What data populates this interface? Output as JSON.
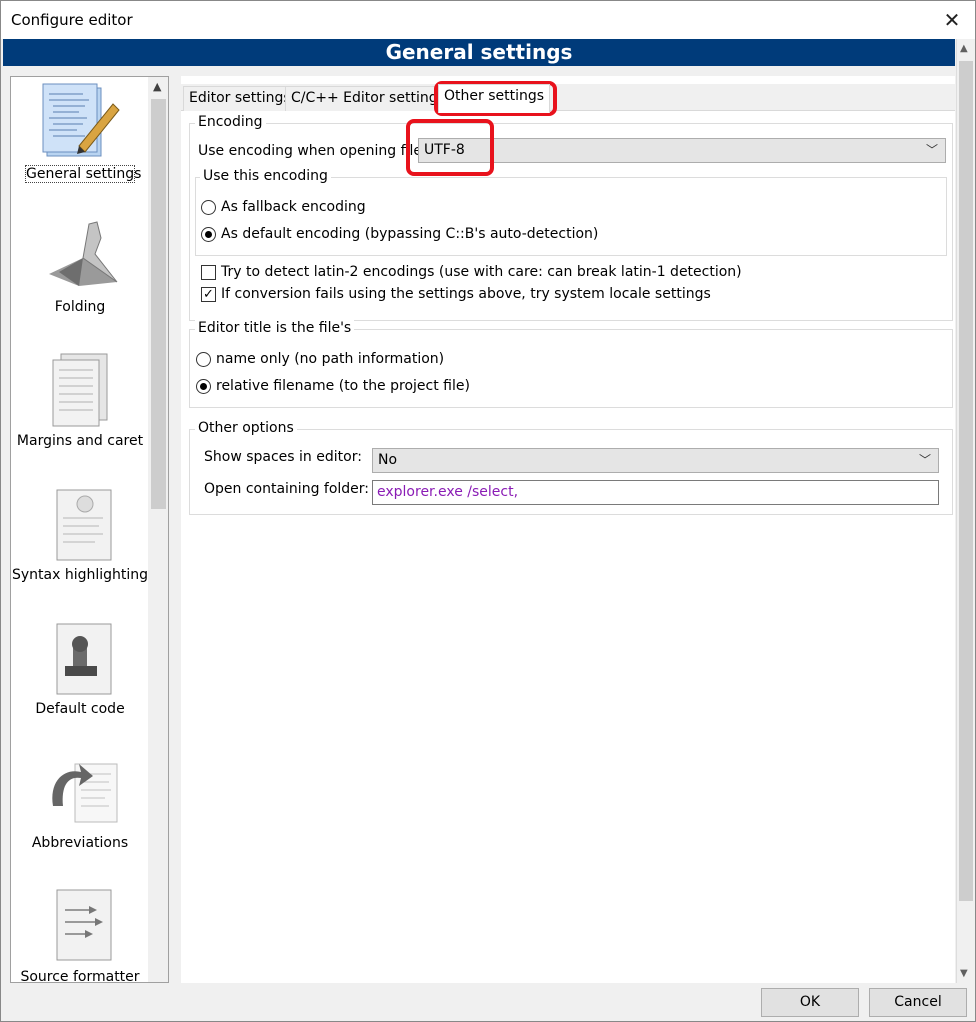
{
  "window": {
    "title": "Configure editor",
    "close": "✕"
  },
  "banner": "General settings",
  "sidebar": {
    "items": [
      {
        "label": "General settings",
        "icon": "general-settings-icon"
      },
      {
        "label": "Folding",
        "icon": "folding-icon"
      },
      {
        "label": "Margins and caret",
        "icon": "margins-icon"
      },
      {
        "label": "Syntax highlighting",
        "icon": "syntax-highlighting-icon"
      },
      {
        "label": "Default code",
        "icon": "default-code-icon"
      },
      {
        "label": "Abbreviations",
        "icon": "abbreviations-icon"
      },
      {
        "label": "Source formatter",
        "icon": "source-formatter-icon"
      }
    ]
  },
  "tabs": [
    "Editor settings",
    "C/C++ Editor settings",
    "Other settings"
  ],
  "encoding": {
    "group_title": "Encoding",
    "label": "Use encoding when opening files",
    "value": "UTF-8",
    "sub_group_title": "Use this encoding",
    "radio_fallback": "As fallback encoding",
    "radio_default": "As default encoding (bypassing C::B's auto-detection)",
    "check_latin2": "Try to detect latin-2 encodings (use with care: can break latin-1 detection)",
    "check_locale": "If conversion fails using the settings above, try system locale settings"
  },
  "title_group": {
    "group_title": "Editor title is the file's",
    "radio_name": "name only (no path information)",
    "radio_relative": "relative filename (to the project file)"
  },
  "other_options": {
    "group_title": "Other options",
    "spaces_label": "Show spaces in editor:",
    "spaces_value": "No",
    "folder_label": "Open containing folder:",
    "folder_value": "explorer.exe /select,"
  },
  "buttons": {
    "ok": "OK",
    "cancel": "Cancel"
  },
  "colors": {
    "banner": "#003b7a",
    "annotation": "#e8121c",
    "folder_text": "#8a1cb5"
  }
}
